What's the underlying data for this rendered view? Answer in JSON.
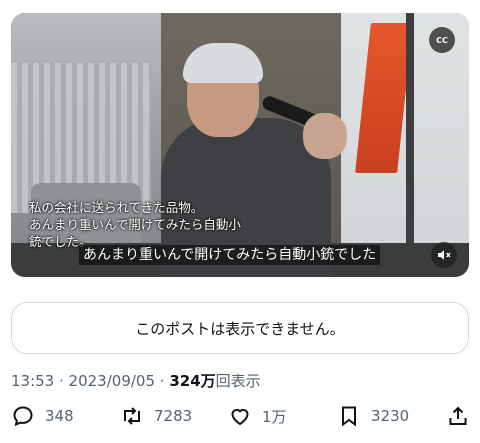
{
  "video": {
    "caption_top_line1": "私の会社に送られてきた品物。",
    "caption_top_line2": "あんまり重いんで開けてみたら自動小",
    "caption_top_line3": "銃でした。",
    "caption_bottom": "あんまり重いんで開けてみたら自動小銃でした",
    "cc_label": "CC",
    "mute_icon": "speaker-muted-icon"
  },
  "notice": {
    "text": "このポストは表示できません。"
  },
  "meta": {
    "time": "13:53",
    "separator1": " · ",
    "date": "2023/09/05",
    "separator2": " · ",
    "views_count": "324万",
    "views_label": "回表示"
  },
  "actions": {
    "reply_count": "348",
    "repost_count": "7283",
    "like_count": "1万",
    "bookmark_count": "3230"
  },
  "colors": {
    "text_primary": "#0f1419",
    "text_secondary": "#536471",
    "border": "#cfd9de"
  }
}
